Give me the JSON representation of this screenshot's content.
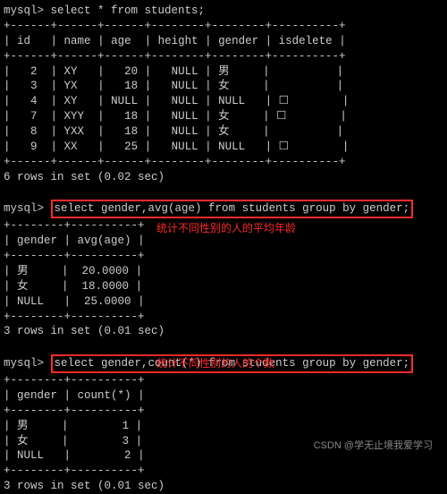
{
  "prompt": "mysql>",
  "queries": {
    "q1": "select * from students;",
    "q2": "select gender,avg(age) from students group by gender;",
    "q3": "select gender,count(*) from students group by gender;"
  },
  "annotations": {
    "a1": "统计不同性别的人的平均年龄",
    "a2": "统计不同性别的人的个数"
  },
  "table1": {
    "headers": [
      "id",
      "name",
      "age",
      "height",
      "gender",
      "isdelete"
    ],
    "rows": [
      [
        "2",
        "XY",
        "20",
        "NULL",
        "男",
        ""
      ],
      [
        "3",
        "YX",
        "18",
        "NULL",
        "女",
        ""
      ],
      [
        "4",
        "XY",
        "NULL",
        "NULL",
        "NULL",
        "☐"
      ],
      [
        "7",
        "XYY",
        "18",
        "NULL",
        "女",
        "☐"
      ],
      [
        "8",
        "YXX",
        "18",
        "NULL",
        "女",
        ""
      ],
      [
        "9",
        "XX",
        "25",
        "NULL",
        "NULL",
        "☐"
      ]
    ],
    "footer": "6 rows in set (0.02 sec)"
  },
  "table2": {
    "headers": [
      "gender",
      "avg(age)"
    ],
    "rows": [
      [
        "男",
        "20.0000"
      ],
      [
        "女",
        "18.0000"
      ],
      [
        "NULL",
        "25.0000"
      ]
    ],
    "footer": "3 rows in set (0.01 sec)"
  },
  "table3": {
    "headers": [
      "gender",
      "count(*)"
    ],
    "rows": [
      [
        "男",
        "1"
      ],
      [
        "女",
        "3"
      ],
      [
        "NULL",
        "2"
      ]
    ],
    "footer": "3 rows in set (0.01 sec)"
  },
  "watermark": "CSDN @学无止境我爱学习"
}
